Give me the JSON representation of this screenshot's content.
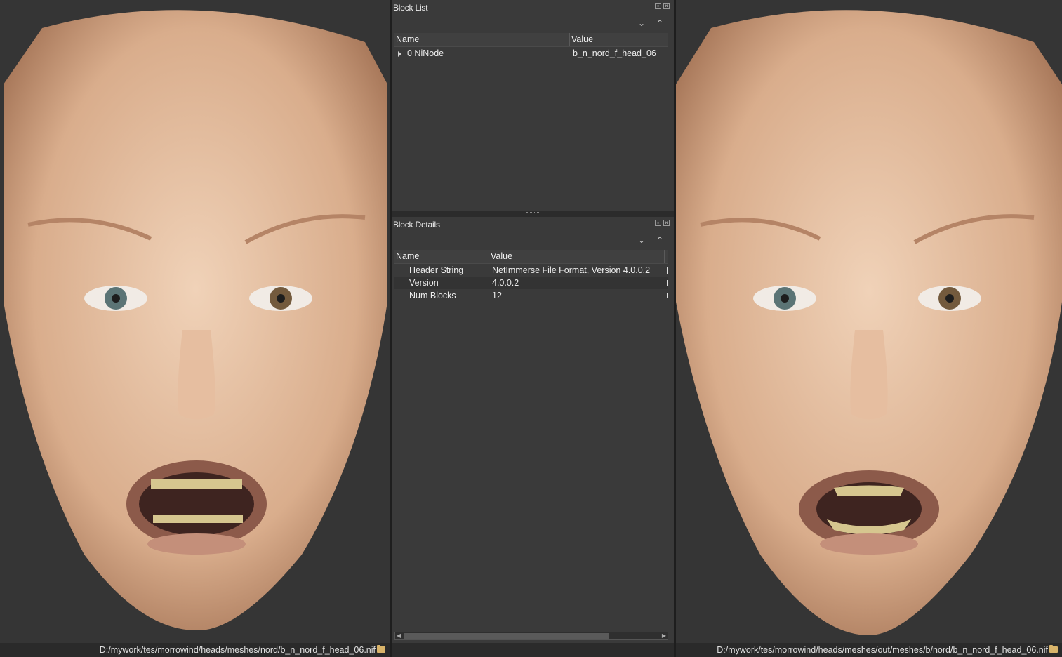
{
  "viewport_left": {
    "status_path": "D:/mywork/tes/morrowind/heads/meshes/nord/b_n_nord_f_head_06.nif",
    "status_icon": "folder-icon"
  },
  "viewport_right": {
    "status_path": "D:/mywork/tes/morrowind/heads/meshes/out/meshes/b/nord/b_n_nord_f_head_06.nif",
    "status_icon": "folder-icon"
  },
  "block_list": {
    "title": "Block List",
    "columns": {
      "name": "Name",
      "value": "Value"
    },
    "rows": [
      {
        "name": "0 NiNode",
        "value": "b_n_nord_f_head_06"
      }
    ]
  },
  "block_details": {
    "title": "Block Details",
    "columns": {
      "name": "Name",
      "value": "Value"
    },
    "rows": [
      {
        "name": "Header String",
        "value": "NetImmerse File Format, Version 4.0.0.2"
      },
      {
        "name": "Version",
        "value": "4.0.0.2"
      },
      {
        "name": "Num Blocks",
        "value": "12"
      }
    ]
  },
  "colors": {
    "skin": "#e8c3a5",
    "background": "#353535",
    "panel": "#3a3a3a"
  }
}
